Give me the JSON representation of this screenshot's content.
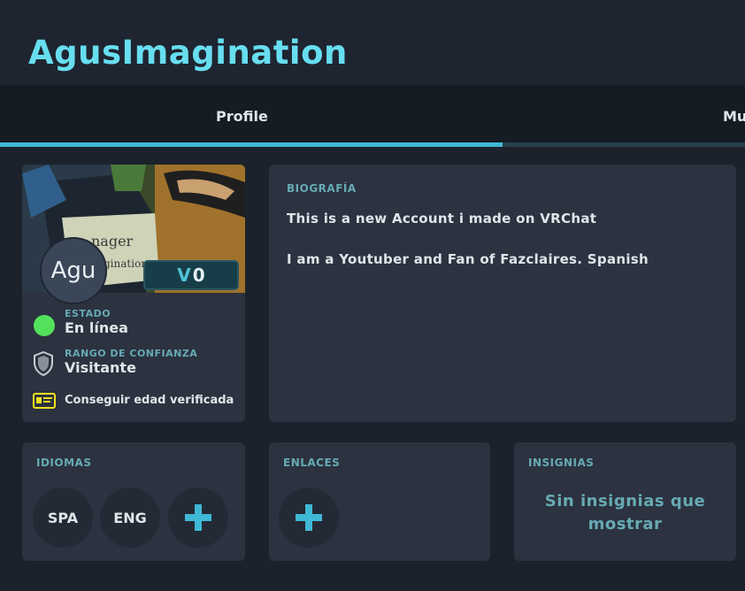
{
  "header": {
    "username": "AgusImagination"
  },
  "tabs": [
    {
      "label": "Profile"
    },
    {
      "label": "Mu"
    }
  ],
  "colors": {
    "accent": "#3fb9d6",
    "title": "#67def0",
    "online": "#53e15c",
    "section_label": "#66aab4"
  },
  "profile": {
    "avatar_text": "Agu",
    "vrc_plus_value": "0",
    "status": {
      "label": "ESTADO",
      "value": "En línea",
      "color": "#53e15c"
    },
    "trust": {
      "label": "RANGO DE CONFIANZA",
      "value": "Visitante",
      "icon": "shield-icon"
    },
    "age_verify_label": "Conseguir edad verificada"
  },
  "bio": {
    "label": "BIOGRAFÍA",
    "lines": [
      "This is a new Account i made on VRChat",
      "I am a Youtuber and Fan of Fazclaires. Spanish"
    ]
  },
  "languages": {
    "label": "IDIOMAS",
    "items": [
      "SPA",
      "ENG"
    ],
    "add_icon": "plus-icon"
  },
  "links": {
    "label": "ENLACES",
    "add_icon": "plus-icon"
  },
  "badges": {
    "label": "INSIGNIAS",
    "empty_text": "Sin insignias que mostrar"
  }
}
